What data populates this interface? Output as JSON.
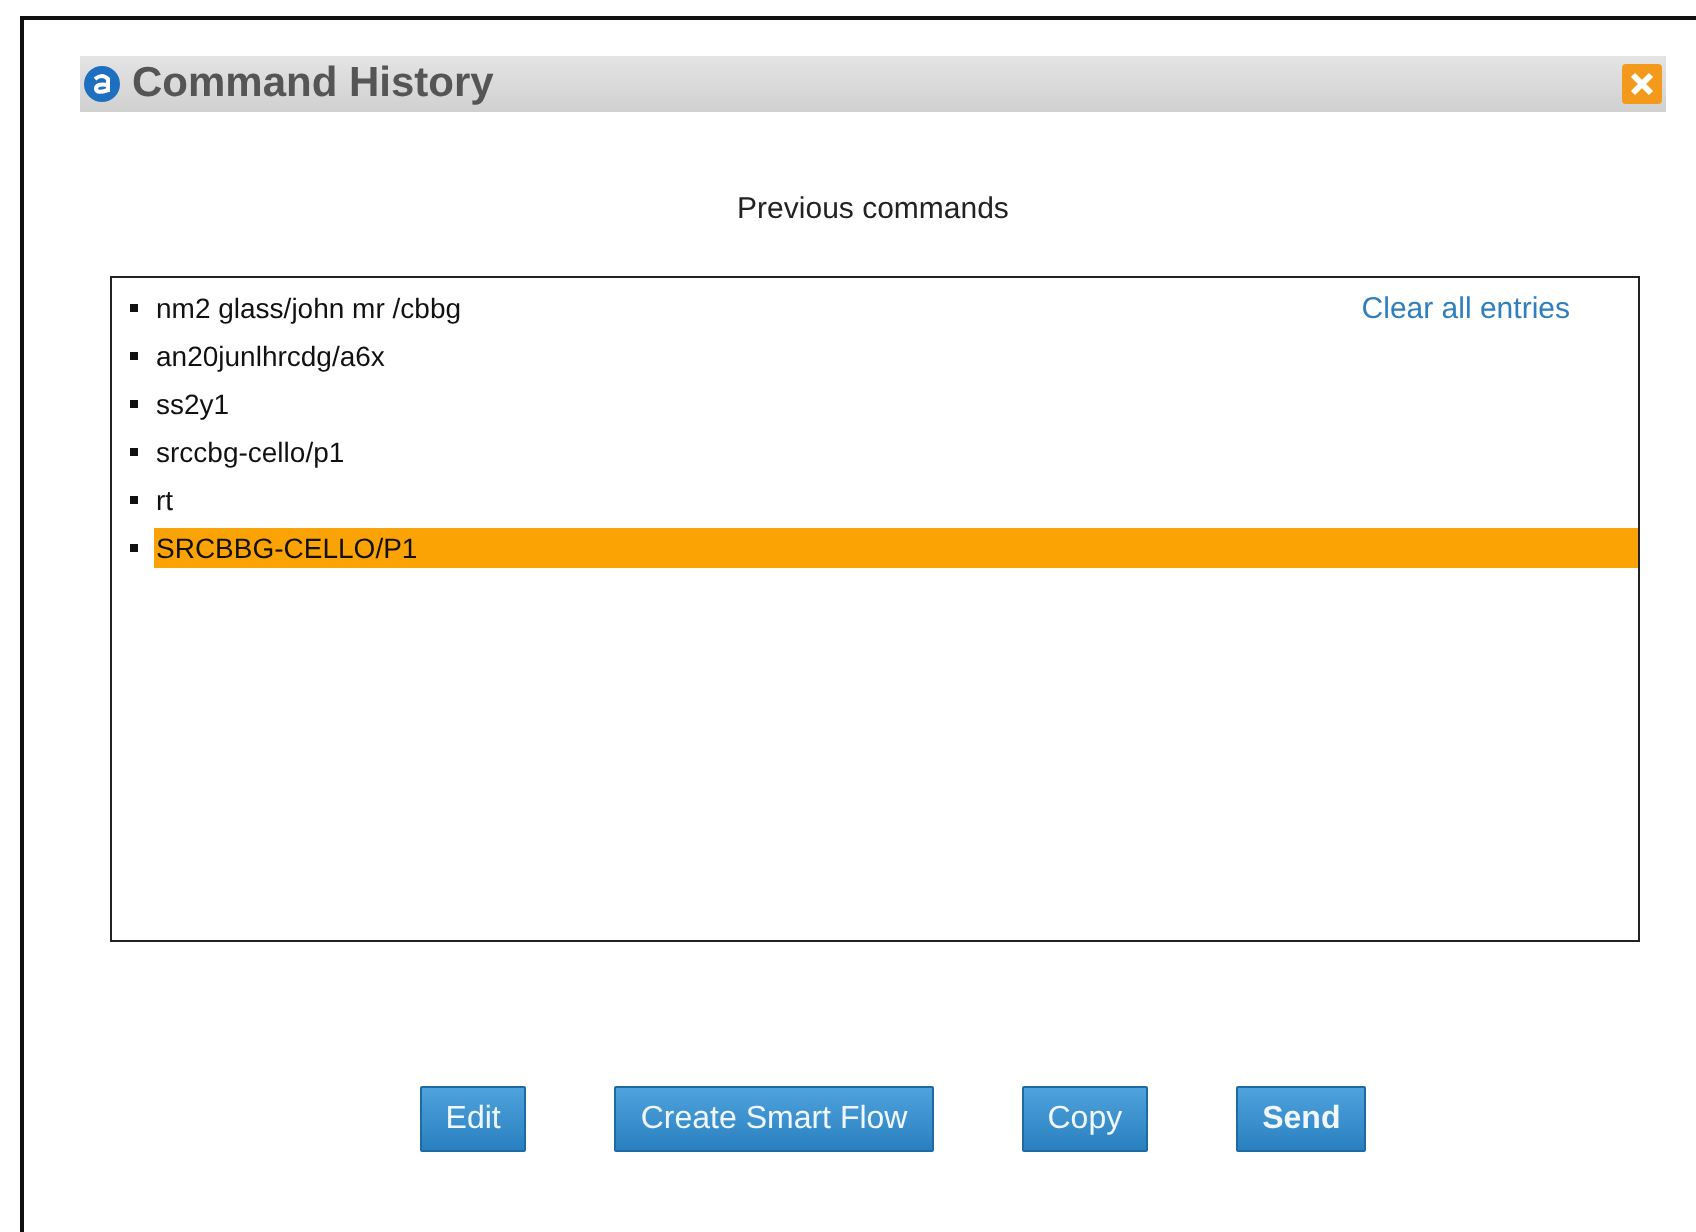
{
  "dialog": {
    "title": "Command History"
  },
  "heading": "Previous commands",
  "clear_link": "Clear all entries",
  "commands": [
    {
      "text": "nm2 glass/john mr /cbbg",
      "selected": false
    },
    {
      "text": "an20junlhrcdg/a6x",
      "selected": false
    },
    {
      "text": "ss2y1",
      "selected": false
    },
    {
      "text": "srccbg-cello/p1",
      "selected": false
    },
    {
      "text": "rt",
      "selected": false
    },
    {
      "text": "SRCBBG-CELLO/P1",
      "selected": true
    }
  ],
  "buttons": [
    {
      "label": "Edit",
      "kind": "normal"
    },
    {
      "label": "Create Smart Flow",
      "kind": "normal"
    },
    {
      "label": "Copy",
      "kind": "normal"
    },
    {
      "label": "Send",
      "kind": "primary"
    }
  ]
}
